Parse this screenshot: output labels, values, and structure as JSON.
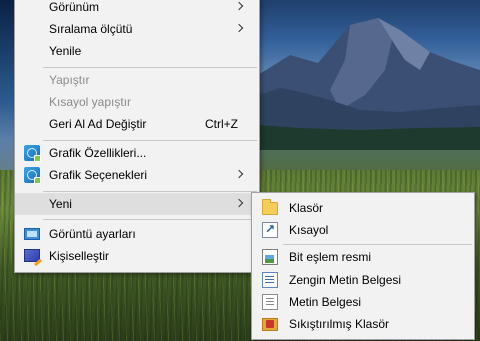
{
  "main_menu": {
    "items": [
      {
        "label": "Görünüm"
      },
      {
        "label": "Sıralama ölçütü"
      },
      {
        "label": "Yenile"
      },
      {
        "label": "Yapıştır"
      },
      {
        "label": "Kısayol yapıştır"
      },
      {
        "label": "Geri Al Ad Değiştir",
        "shortcut": "Ctrl+Z"
      },
      {
        "label": "Grafik Özellikleri...",
        "icon": "graphics-properties-icon"
      },
      {
        "label": "Grafik Seçenekleri",
        "icon": "graphics-options-icon"
      },
      {
        "label": "Yeni"
      },
      {
        "label": "Görüntü ayarları",
        "icon": "display-settings-icon"
      },
      {
        "label": "Kişiselleştir",
        "icon": "personalize-icon"
      }
    ]
  },
  "sub_menu": {
    "items": [
      {
        "label": "Klasör",
        "icon": "folder-icon"
      },
      {
        "label": "Kısayol",
        "icon": "shortcut-icon"
      },
      {
        "label": "Bit eşlem resmi",
        "icon": "bitmap-image-icon"
      },
      {
        "label": "Zengin Metin Belgesi",
        "icon": "rich-text-document-icon"
      },
      {
        "label": "Metin Belgesi",
        "icon": "text-document-icon"
      },
      {
        "label": "Sıkıştırılmış Klasör",
        "icon": "compressed-folder-icon"
      }
    ]
  },
  "colors": {
    "menu_background": "#f2f2f2",
    "menu_border": "#a0a0a0",
    "highlight": "#dedede",
    "disabled_text": "#8a8a8a"
  }
}
